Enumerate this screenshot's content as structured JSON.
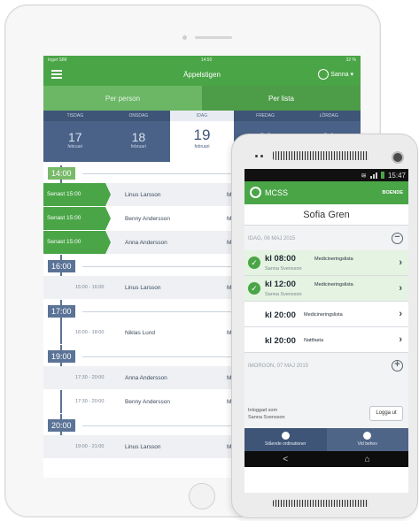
{
  "tablet": {
    "status": {
      "carrier": "Inget SIM",
      "time": "14:50",
      "battery": "32 %"
    },
    "header": {
      "title": "Äppelstigen",
      "user": "Sanna"
    },
    "tabs": [
      {
        "label": "Per person"
      },
      {
        "label": "Per lista"
      }
    ],
    "days": [
      {
        "name": "TISDAG",
        "date": "17",
        "month": "februari"
      },
      {
        "name": "ONSDAG",
        "date": "18",
        "month": "februari"
      },
      {
        "name": "IDAG",
        "date": "19",
        "month": "februari"
      },
      {
        "name": "FREDAG",
        "date": "20",
        "month": ""
      },
      {
        "name": "LÖRDAG",
        "date": "21",
        "month": ""
      }
    ],
    "hours": [
      "14:00",
      "16:00",
      "17:00",
      "19:00",
      "20:00"
    ],
    "rows_1400": [
      {
        "flag": "Senast 15:00",
        "name": "Linus Larsson"
      },
      {
        "flag": "Senast 15:00",
        "name": "Benny Andersson"
      },
      {
        "flag": "Senast 15:00",
        "name": "Anna  Andersson"
      }
    ],
    "rows_1600": [
      {
        "time": "15:00 - 16:00",
        "name": "Linus Larsson"
      }
    ],
    "rows_1700": [
      {
        "time": "16:00 - 18:00",
        "name": "Niklas Lund"
      }
    ],
    "rows_1900": [
      {
        "time": "17:30 - 20:00",
        "name": "Anna  Andersson"
      },
      {
        "time": "17:30 - 20:00",
        "name": "Benny Andersson"
      }
    ],
    "rows_2000": [
      {
        "time": "19:00 - 21:00",
        "name": "Linus Larsson"
      }
    ],
    "truncated": "M"
  },
  "phone": {
    "status_time": "15:47",
    "app": {
      "name": "MCSS",
      "right_label": "BOENDE"
    },
    "patient": "Sofia Gren",
    "today_label": "IDAG, 06 MAJ 2015",
    "items": [
      {
        "time": "kl 08:00",
        "list": "Medicineringslista",
        "who": "Sanna Svensson"
      },
      {
        "time": "kl 12:00",
        "list": "Medicineringslista",
        "who": "Sanna Svensson"
      },
      {
        "time": "kl 20:00",
        "list": "Medicineringslista"
      },
      {
        "time": "kl 20:00",
        "list": "Nattfasta"
      }
    ],
    "tomorrow_label": "IMORGON, 07 MAJ 2015",
    "login": {
      "line1": "Inloggad som",
      "line2": "Sanna Svensson",
      "logout": "Logga ut"
    },
    "bottom_tabs": [
      {
        "label": "Stående ordinationer"
      },
      {
        "label": "Vid behov"
      }
    ],
    "nav": {
      "back": "<",
      "home": "⌂"
    }
  }
}
